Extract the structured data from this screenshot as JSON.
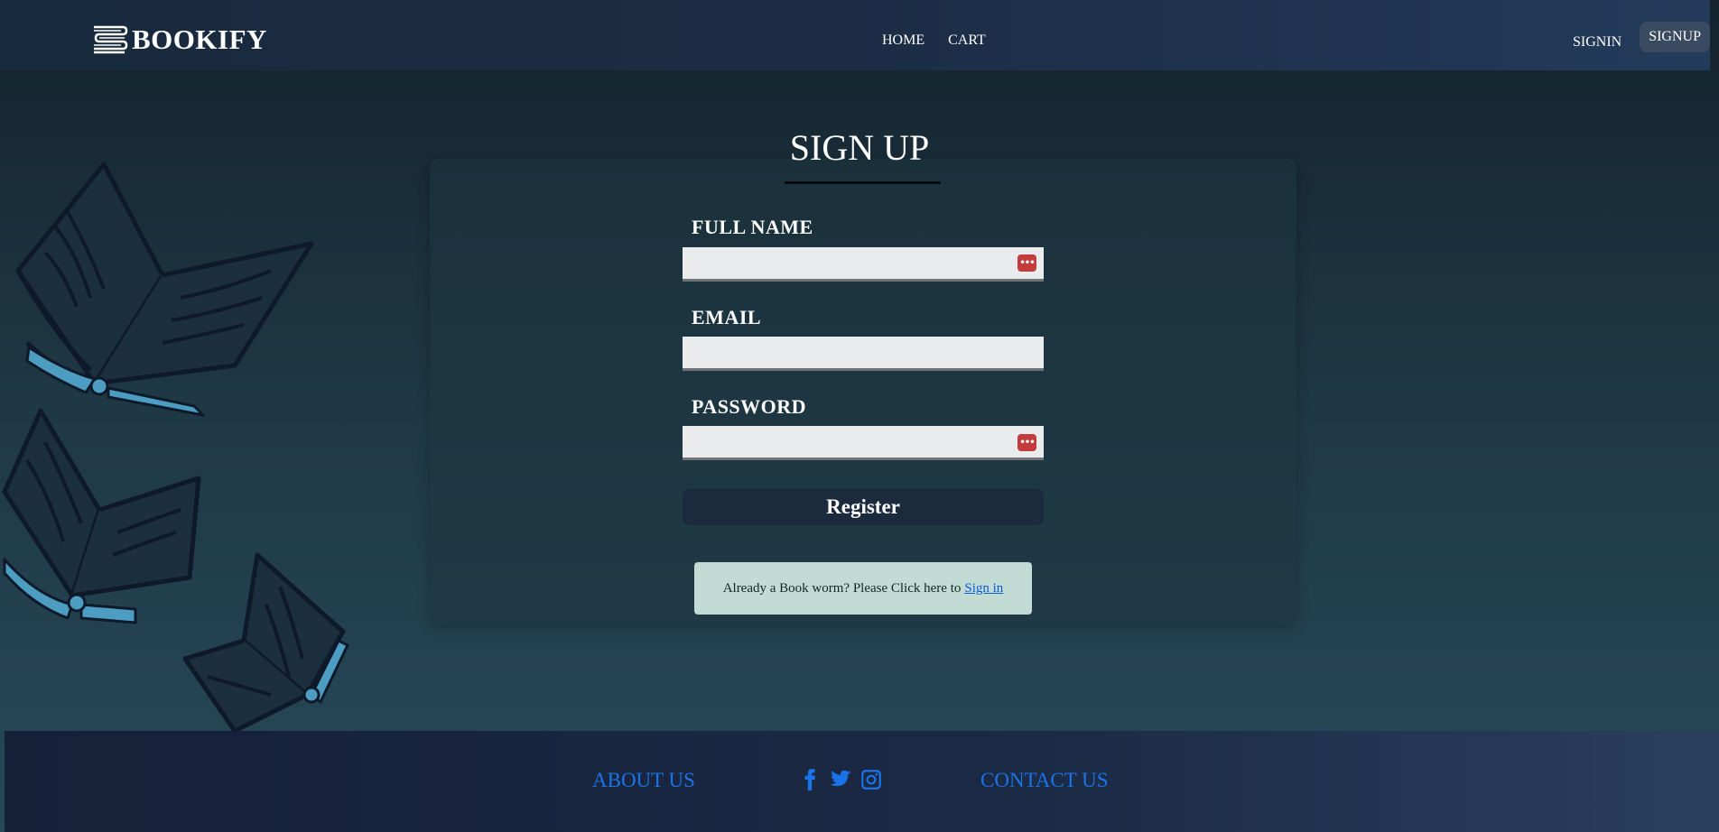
{
  "navbar": {
    "brand": "BOOKIFY",
    "links": [
      "HOME",
      "CART"
    ],
    "signin_label": "SIGNIN",
    "signup_label": "SIGNUP"
  },
  "form": {
    "title": "SIGN UP",
    "fields": [
      {
        "label": "FULL NAME",
        "value": "",
        "icon": "password-manager-icon"
      },
      {
        "label": "EMAIL",
        "value": ""
      },
      {
        "label": "PASSWORD",
        "value": "",
        "icon": "password-manager-icon"
      }
    ],
    "register_label": "Register",
    "note_text": "Already a Book worm? Please Click here to",
    "note_link": "Sign in"
  },
  "footer": {
    "about_label": "ABOUT US",
    "contact_label": "CONTACT US",
    "social_icons": [
      "facebook-icon",
      "twitter-icon",
      "instagram-icon"
    ]
  },
  "colors": {
    "accent": "#1a73e8",
    "button": "#1b2b3d",
    "note_bg": "#c2dbd5",
    "key_icon": "#c43b3b"
  }
}
